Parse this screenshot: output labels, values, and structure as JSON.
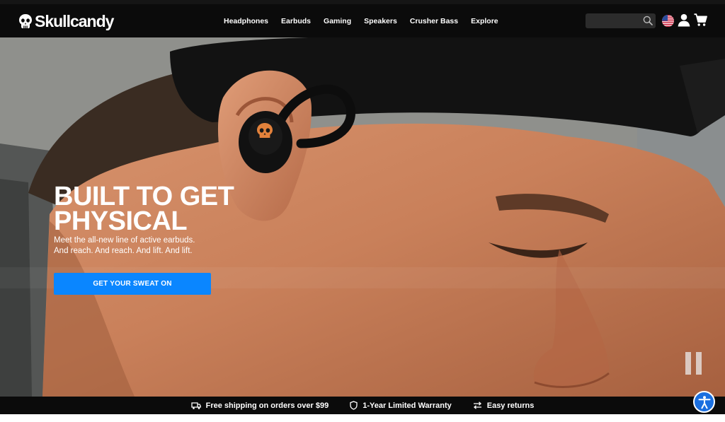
{
  "brand": {
    "name": "Skullcandy"
  },
  "nav": {
    "items": [
      {
        "label": "Headphones"
      },
      {
        "label": "Earbuds"
      },
      {
        "label": "Gaming"
      },
      {
        "label": "Speakers"
      },
      {
        "label": "Crusher Bass"
      },
      {
        "label": "Explore"
      }
    ]
  },
  "search": {
    "placeholder": "",
    "value": ""
  },
  "hero": {
    "title": "BUILT TO GET PHYSICAL",
    "subtitle_line1": "Meet the all-new line of active earbuds.",
    "subtitle_line2": "And reach. And reach. And lift. And lift.",
    "cta_label": "GET YOUR SWEAT ON"
  },
  "promo": {
    "shipping": "Free shipping on orders over $99",
    "warranty": "1-Year Limited Warranty",
    "returns": "Easy returns"
  },
  "icons": {
    "logo": "skull-icon",
    "search": "search-icon",
    "flag": "us-flag-icon",
    "account": "user-icon",
    "cart": "cart-icon",
    "pause": "pause-icon",
    "shipping": "truck-icon",
    "warranty": "shield-icon",
    "returns": "returns-arrows-icon",
    "accessibility": "accessibility-icon"
  },
  "colors": {
    "header_bg": "#0b0b0b",
    "cta_bg": "#0a86ff",
    "accessibility_bg": "#1a6fe0",
    "earbud_accent": "#e2813b"
  }
}
